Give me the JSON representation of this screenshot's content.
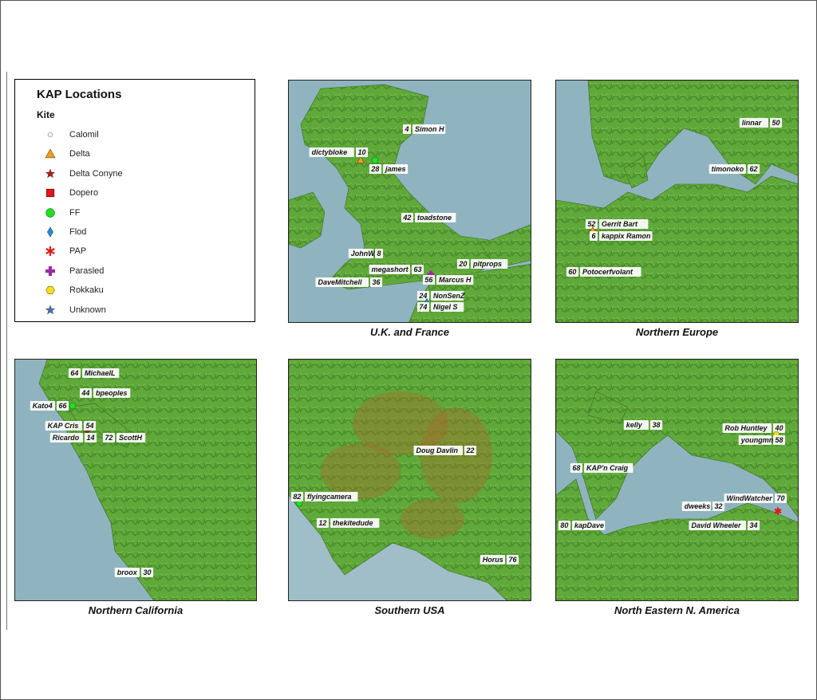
{
  "legend": {
    "title": "KAP Locations",
    "subtitle": "Kite",
    "items": [
      {
        "label": "Calomil",
        "symbol": "dot",
        "color": "#aaaaaa"
      },
      {
        "label": "Delta",
        "symbol": "triangle",
        "color": "#f0a020"
      },
      {
        "label": "Delta Conyne",
        "symbol": "star",
        "color": "#a82020"
      },
      {
        "label": "Dopero",
        "symbol": "square",
        "color": "#dd1a1a"
      },
      {
        "label": "FF",
        "symbol": "circle",
        "color": "#22dd22"
      },
      {
        "label": "Flod",
        "symbol": "diamond",
        "color": "#2a8fd0"
      },
      {
        "label": "PAP",
        "symbol": "asterisk",
        "color": "#dd1a1a"
      },
      {
        "label": "Parasled",
        "symbol": "cross",
        "color": "#9a2aa0"
      },
      {
        "label": "Rokkaku",
        "symbol": "hexagon",
        "color": "#f0e020"
      },
      {
        "label": "Unknown",
        "symbol": "star",
        "color": "#4a70b8"
      }
    ]
  },
  "panels": [
    {
      "caption": "U.K. and France",
      "markers": [
        {
          "name": "Simon H",
          "num": "4",
          "kite": "Delta"
        },
        {
          "name": "dictybloke",
          "num": "10",
          "kite": "Delta"
        },
        {
          "name": "james",
          "num": "28",
          "kite": "FF"
        },
        {
          "name": "toadstone",
          "num": "42",
          "kite": "Delta Conyne"
        },
        {
          "name": "JohnW",
          "num": "8",
          "kite": "Delta"
        },
        {
          "name": "pitprops",
          "num": "20",
          "kite": "FF"
        },
        {
          "name": "megashort",
          "num": "63",
          "kite": "Parasled"
        },
        {
          "name": "Marcus H",
          "num": "56",
          "kite": "Parasled"
        },
        {
          "name": "DaveMitchell",
          "num": "36",
          "kite": "Flod"
        },
        {
          "name": "NonSenZ",
          "num": "24",
          "kite": "Flod"
        },
        {
          "name": "Nigel S",
          "num": "74",
          "kite": "Flod"
        }
      ]
    },
    {
      "caption": "Northern Europe",
      "markers": [
        {
          "name": "linnar",
          "num": "50",
          "kite": "Delta"
        },
        {
          "name": "timonoko",
          "num": "62",
          "kite": "FF"
        },
        {
          "name": "Gerrit Bart",
          "num": "52",
          "kite": "Delta"
        },
        {
          "name": "kappix Ramon",
          "num": "6",
          "kite": "Delta"
        },
        {
          "name": "Potocerfvolant",
          "num": "60",
          "kite": "Dopero"
        }
      ]
    },
    {
      "caption": "Northern California",
      "markers": [
        {
          "name": "MichaelL",
          "num": "64",
          "kite": "Rokkaku"
        },
        {
          "name": "bpeoples",
          "num": "44",
          "kite": "FF"
        },
        {
          "name": "Kato4",
          "num": "66",
          "kite": "FF"
        },
        {
          "name": "KAP Cris",
          "num": "54",
          "kite": "Delta Conyne"
        },
        {
          "name": "Ricardo",
          "num": "14",
          "kite": "FF"
        },
        {
          "name": "ScottH",
          "num": "72",
          "kite": "FF"
        },
        {
          "name": "broox",
          "num": "30",
          "kite": "Flod"
        }
      ]
    },
    {
      "caption": "Southern USA",
      "markers": [
        {
          "name": "Doug Davlin",
          "num": "22",
          "kite": "Delta"
        },
        {
          "name": "flyingcamera",
          "num": "82",
          "kite": "FF"
        },
        {
          "name": "thekitedude",
          "num": "12",
          "kite": "Flod"
        },
        {
          "name": "Horus",
          "num": "76",
          "kite": "FF"
        }
      ]
    },
    {
      "caption": "North Eastern N. America",
      "markers": [
        {
          "name": "kelly",
          "num": "38",
          "kite": "Rokkaku"
        },
        {
          "name": "Rob Huntley",
          "num": "40",
          "kite": "Rokkaku"
        },
        {
          "name": "youngmm",
          "num": "58",
          "kite": "Rokkaku"
        },
        {
          "name": "KAP'n Craig",
          "num": "68",
          "kite": "FF"
        },
        {
          "name": "WindWatcher",
          "num": "70",
          "kite": "PAP"
        },
        {
          "name": "dweeks",
          "num": "32",
          "kite": "Delta"
        },
        {
          "name": "David Wheeler",
          "num": "34",
          "kite": "Dopero"
        },
        {
          "name": "kapDave",
          "num": "80",
          "kite": "Calomil"
        }
      ]
    }
  ]
}
